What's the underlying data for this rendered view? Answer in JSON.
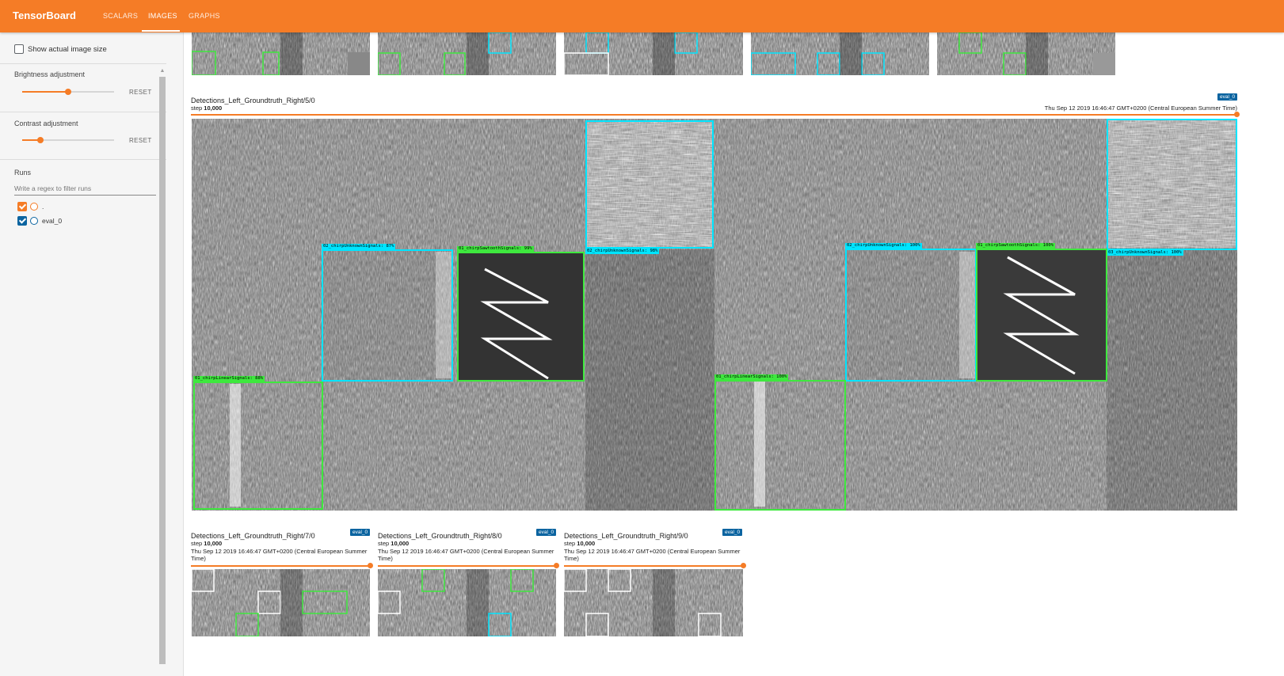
{
  "app": {
    "title": "TensorBoard"
  },
  "tabs": [
    {
      "label": "SCALARS",
      "active": false
    },
    {
      "label": "IMAGES",
      "active": true
    },
    {
      "label": "GRAPHS",
      "active": false
    }
  ],
  "sidebar": {
    "show_actual_size_label": "Show actual image size",
    "show_actual_size_checked": false,
    "brightness": {
      "label": "Brightness adjustment",
      "reset_label": "RESET",
      "value_fraction": 0.5
    },
    "contrast": {
      "label": "Contrast adjustment",
      "reset_label": "RESET",
      "value_fraction": 0.2
    },
    "runs": {
      "heading": "Runs",
      "filter_placeholder": "Write a regex to filter runs",
      "items": [
        {
          "label": ".",
          "checked": true,
          "color": "#f57c26"
        },
        {
          "label": "eval_0",
          "checked": true,
          "color": "#0b64a0"
        }
      ]
    }
  },
  "main_card": {
    "title": "Detections_Left_Groundtruth_Right/5/0",
    "step_prefix": "step",
    "step_value": "10,000",
    "timestamp": "Thu Sep 12 2019 16:46:47 GMT+0200 (Central European Summer Time)",
    "run_badge": "eval_0",
    "detections": [
      {
        "label": "02_chirpUnknownSignals: 87%",
        "color": "#00e5ff"
      },
      {
        "label": "01_chirpSawtoothSignals: 99%",
        "color": "#3ee83e"
      },
      {
        "label": "02_chirpUnknownSignals: 98%",
        "color": "#00e5ff"
      },
      {
        "label": "01_chirpLinearSignals: 88%",
        "color": "#3ee83e"
      },
      {
        "label": "01_chirpLinearSignals: 100%",
        "color": "#3ee83e"
      },
      {
        "label": "02_chirpUnknownSignals: 100%",
        "color": "#00e5ff"
      },
      {
        "label": "01_chirpSawtoothSignals: 100%",
        "color": "#3ee83e"
      },
      {
        "label": "03_chirpUnknownSignals: 100%",
        "color": "#00e5ff"
      }
    ]
  },
  "bottom_cards": [
    {
      "title": "Detections_Left_Groundtruth_Right/7/0",
      "step_prefix": "step",
      "step_value": "10,000",
      "timestamp": "Thu Sep 12 2019 16:46:47 GMT+0200 (Central European Summer Time)",
      "run_badge": "eval_0"
    },
    {
      "title": "Detections_Left_Groundtruth_Right/8/0",
      "step_prefix": "step",
      "step_value": "10,000",
      "timestamp": "Thu Sep 12 2019 16:46:47 GMT+0200 (Central European Summer Time)",
      "run_badge": "eval_0"
    },
    {
      "title": "Detections_Left_Groundtruth_Right/9/0",
      "step_prefix": "step",
      "step_value": "10,000",
      "timestamp": "Thu Sep 12 2019 16:46:47 GMT+0200 (Central European Summer Time)",
      "run_badge": "eval_0"
    }
  ],
  "colors": {
    "accent": "#f57c26",
    "run_blue": "#0b64a0",
    "detection_cyan": "#00e5ff",
    "groundtruth_green": "#3ee83e"
  }
}
